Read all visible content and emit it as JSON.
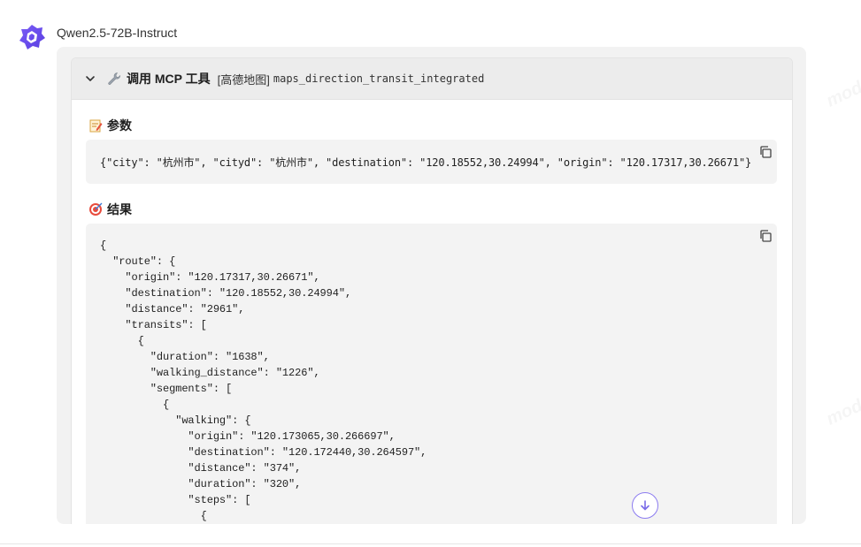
{
  "message": {
    "model_name": "Qwen2.5-72B-Instruct"
  },
  "tool_call": {
    "title": "调用 MCP 工具",
    "provider_tag": "[高德地图]",
    "tool_name": "maps_direction_transit_integrated",
    "params_label": "参数",
    "params_json": "{\"city\": \"杭州市\", \"cityd\": \"杭州市\", \"destination\": \"120.18552,30.24994\", \"origin\": \"120.17317,30.26671\"}",
    "result_label": "结果",
    "result_json": "{\n  \"route\": {\n    \"origin\": \"120.17317,30.26671\",\n    \"destination\": \"120.18552,30.24994\",\n    \"distance\": \"2961\",\n    \"transits\": [\n      {\n        \"duration\": \"1638\",\n        \"walking_distance\": \"1226\",\n        \"segments\": [\n          {\n            \"walking\": {\n              \"origin\": \"120.173065,30.266697\",\n              \"destination\": \"120.172440,30.264597\",\n              \"distance\": \"374\",\n              \"duration\": \"320\",\n              \"steps\": [\n                {"
  },
  "watermark": "modelscope",
  "icons": {
    "avatar": "qwen-logo-icon",
    "expand": "chevron-down-icon",
    "tool": "wrench-icon",
    "params": "memo-icon",
    "result": "target-icon",
    "copy": "copy-icon",
    "scroll": "arrow-down-circle-icon"
  },
  "colors": {
    "brand": "#6b5cf0",
    "accent_scroll": "#8c7cf0"
  }
}
